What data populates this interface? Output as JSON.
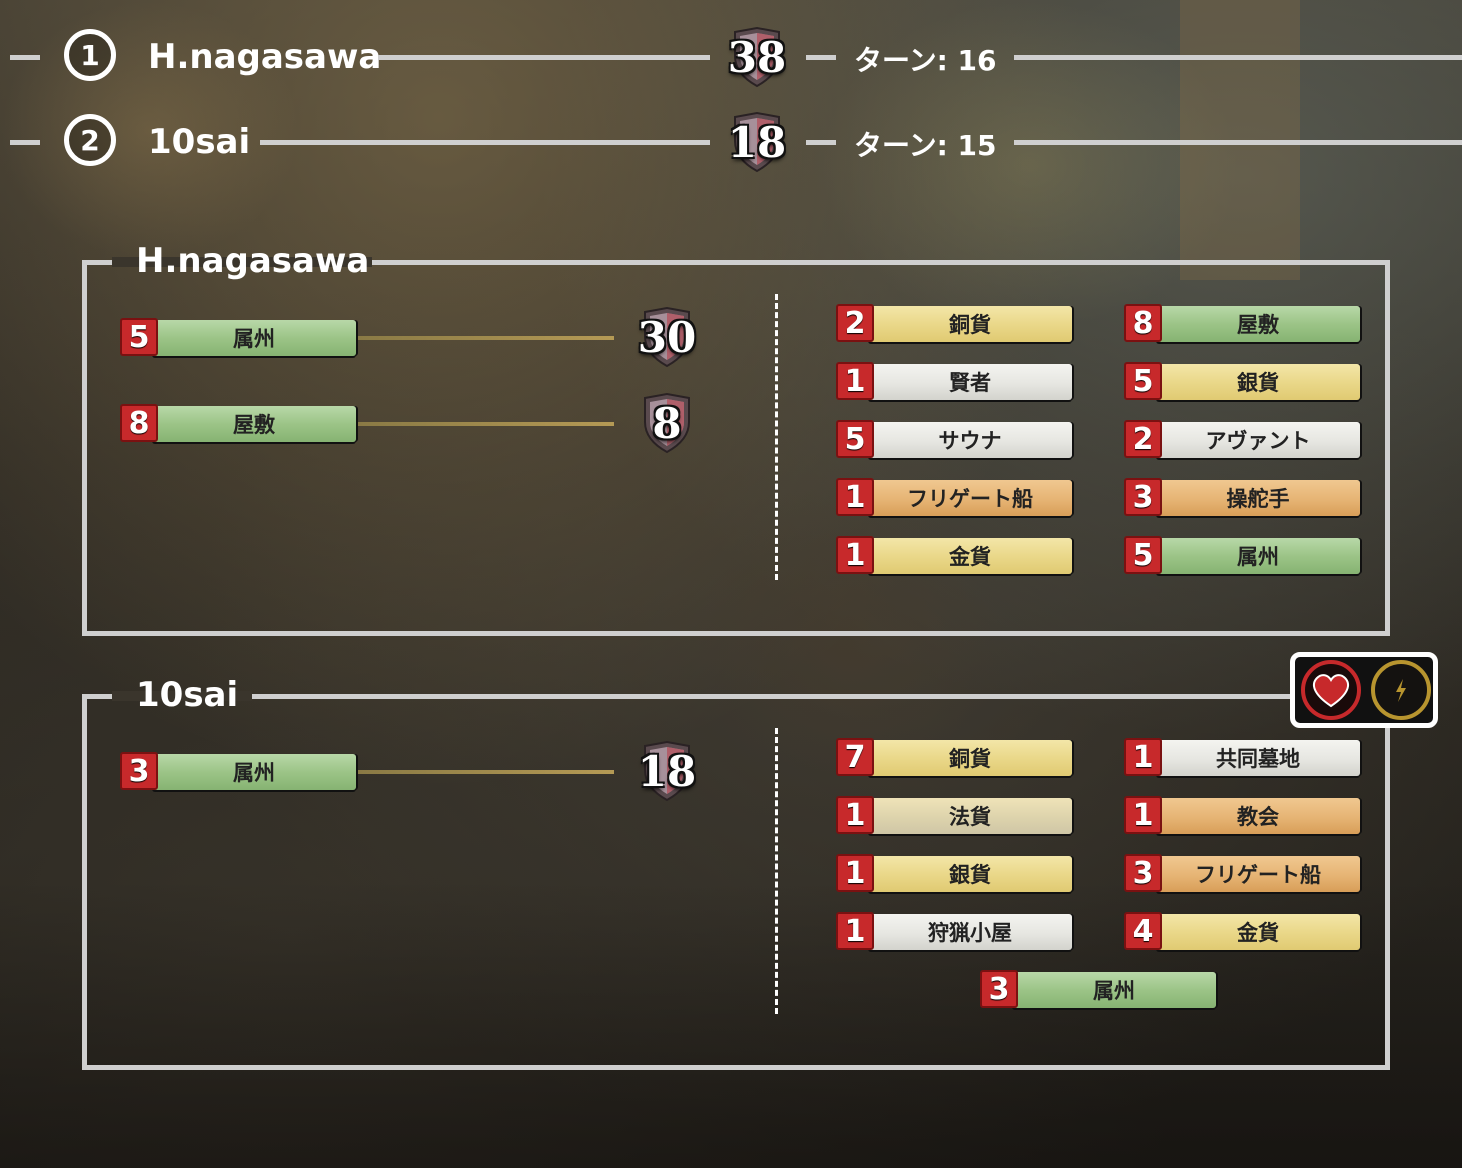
{
  "scoreboard": [
    {
      "rank": "1",
      "name": "H.nagasawa",
      "score": "38",
      "turn": "ターン: 16"
    },
    {
      "rank": "2",
      "name": "10sai",
      "score": "18",
      "turn": "ターン: 15"
    }
  ],
  "panels": [
    {
      "title": "H.nagasawa",
      "left_cards": [
        {
          "count": "5",
          "label": "属州",
          "color": "green",
          "points": "30"
        },
        {
          "count": "8",
          "label": "屋敷",
          "color": "green",
          "points": "8"
        }
      ],
      "right_cards": [
        {
          "count": "2",
          "label": "銅貨",
          "color": "yellow"
        },
        {
          "count": "8",
          "label": "屋敷",
          "color": "green"
        },
        {
          "count": "1",
          "label": "賢者",
          "color": "white"
        },
        {
          "count": "5",
          "label": "銀貨",
          "color": "yellow"
        },
        {
          "count": "5",
          "label": "サウナ",
          "color": "white"
        },
        {
          "count": "2",
          "label": "アヴァント",
          "color": "white"
        },
        {
          "count": "1",
          "label": "フリゲート船",
          "color": "orange"
        },
        {
          "count": "3",
          "label": "操舵手",
          "color": "orange"
        },
        {
          "count": "1",
          "label": "金貨",
          "color": "yellow"
        },
        {
          "count": "5",
          "label": "属州",
          "color": "green"
        }
      ]
    },
    {
      "title": "10sai",
      "left_cards": [
        {
          "count": "3",
          "label": "属州",
          "color": "green",
          "points": "18"
        }
      ],
      "right_cards": [
        {
          "count": "7",
          "label": "銅貨",
          "color": "yellow"
        },
        {
          "count": "1",
          "label": "共同墓地",
          "color": "white"
        },
        {
          "count": "1",
          "label": "法貨",
          "color": "beige"
        },
        {
          "count": "1",
          "label": "教会",
          "color": "orange"
        },
        {
          "count": "1",
          "label": "銀貨",
          "color": "yellow"
        },
        {
          "count": "3",
          "label": "フリゲート船",
          "color": "orange"
        },
        {
          "count": "1",
          "label": "狩猟小屋",
          "color": "white"
        },
        {
          "count": "4",
          "label": "金貨",
          "color": "yellow"
        },
        {
          "count": "3",
          "label": "属州",
          "color": "green"
        }
      ]
    }
  ],
  "icons": {
    "heart": "heart-icon",
    "bolt": "lightning-icon",
    "heart_color": "#c7292b",
    "bolt_color": "#b8952f"
  }
}
